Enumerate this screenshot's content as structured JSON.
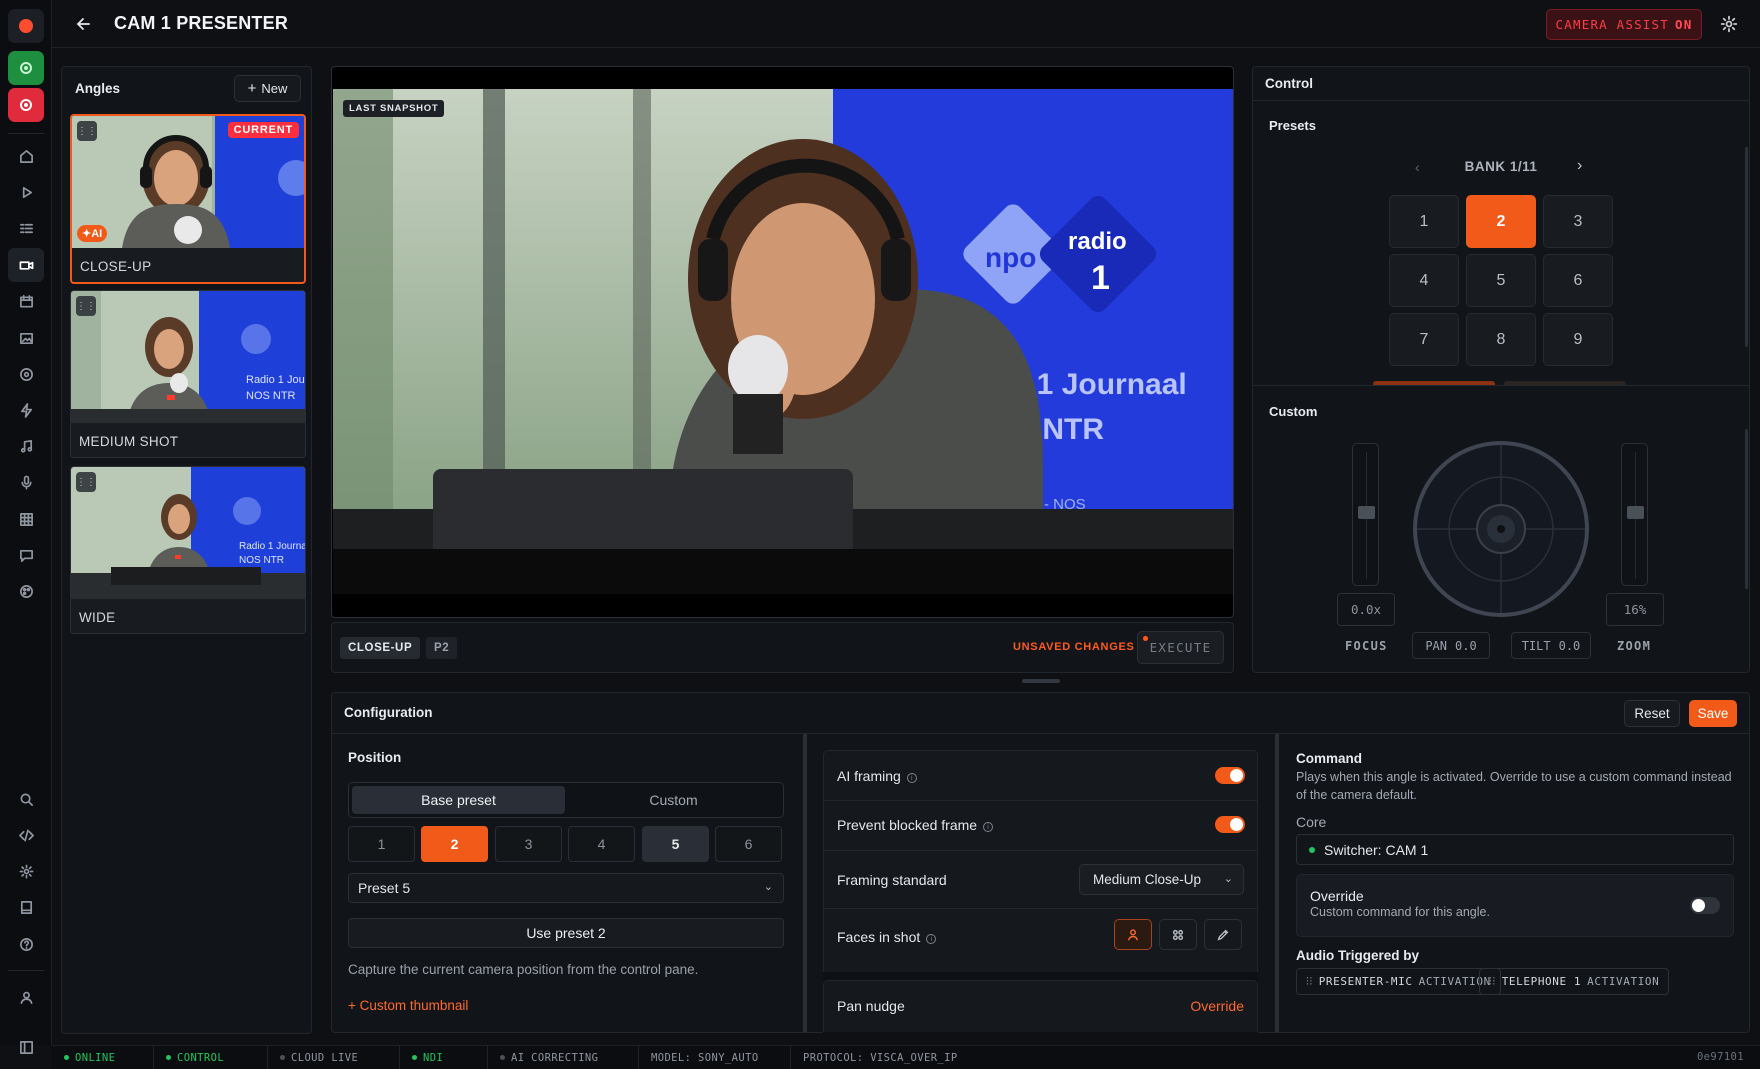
{
  "header": {
    "title": "CAM 1 PRESENTER",
    "assist_label": "CAMERA ASSIST",
    "assist_state": "ON"
  },
  "angles": {
    "title": "Angles",
    "new_label": "New",
    "items": [
      {
        "label": "CLOSE-UP",
        "badge": "CURRENT",
        "ai_badge": "AI"
      },
      {
        "label": "MEDIUM SHOT"
      },
      {
        "label": "WIDE"
      }
    ]
  },
  "preview": {
    "snapshot_label": "LAST SNAPSHOT",
    "angle_tag": "CLOSE-UP",
    "preset_tag": "P2",
    "unsaved": "UNSAVED CHANGES",
    "execute": "EXECUTE",
    "scene": {
      "brand_npo": "npo",
      "brand_radio": "radio",
      "brand_one": "1",
      "banner_line1": "Radio 1 Journaal",
      "banner_line2": "NOS NTR",
      "banner_line3": "NTR - NOS"
    }
  },
  "control": {
    "title": "Control",
    "presets_title": "Presets",
    "bank": "BANK 1/11",
    "presets": [
      "1",
      "2",
      "3",
      "4",
      "5",
      "6",
      "7",
      "8",
      "9"
    ],
    "selected_preset": "2",
    "custom_title": "Custom",
    "focus_value": "0.0x",
    "zoom_value": "16%",
    "focus_label": "FOCUS",
    "zoom_label": "ZOOM",
    "pan_label": "PAN",
    "pan_value": "0.0",
    "tilt_label": "TILT",
    "tilt_value": "0.0"
  },
  "config": {
    "title": "Configuration",
    "reset": "Reset",
    "save": "Save",
    "position": {
      "title": "Position",
      "tab_base": "Base preset",
      "tab_custom": "Custom",
      "numbers": [
        "1",
        "2",
        "3",
        "4",
        "5",
        "6"
      ],
      "select_value": "Preset 5",
      "use_button": "Use preset 2",
      "help": "Capture the current camera position from the control pane.",
      "thumb_link": "+ Custom thumbnail"
    },
    "framing": {
      "ai_framing": "AI framing",
      "ai_framing_on": true,
      "prevent_blocked": "Prevent blocked frame",
      "prevent_blocked_on": true,
      "standard_label": "Framing standard",
      "standard_value": "Medium Close-Up",
      "faces_label": "Faces in shot",
      "pan_nudge": "Pan nudge",
      "override_link": "Override"
    },
    "command": {
      "title": "Command",
      "desc": "Plays when this angle is activated. Override to use a custom command instead of the camera default.",
      "core_label": "Core",
      "core_value": "Switcher: CAM 1",
      "override_title": "Override",
      "override_desc": "Custom command for this angle.",
      "audio_title": "Audio Triggered by",
      "chips": [
        {
          "name": "PRESENTER-MIC",
          "suffix": "ACTIVATION"
        },
        {
          "name": "TELEPHONE 1",
          "suffix": "ACTIVATION"
        }
      ]
    }
  },
  "status": {
    "items": [
      "ONLINE",
      "CONTROL",
      "CLOUD LIVE",
      "NDI",
      "AI CORRECTING",
      "MODEL: SONY_AUTO",
      "PROTOCOL: VISCA_OVER_IP"
    ],
    "build": "0e97101"
  },
  "colors": {
    "accent": "#f15a19",
    "danger": "#ff2e3e",
    "ok": "#22c55e",
    "bg": "#0e1014"
  }
}
